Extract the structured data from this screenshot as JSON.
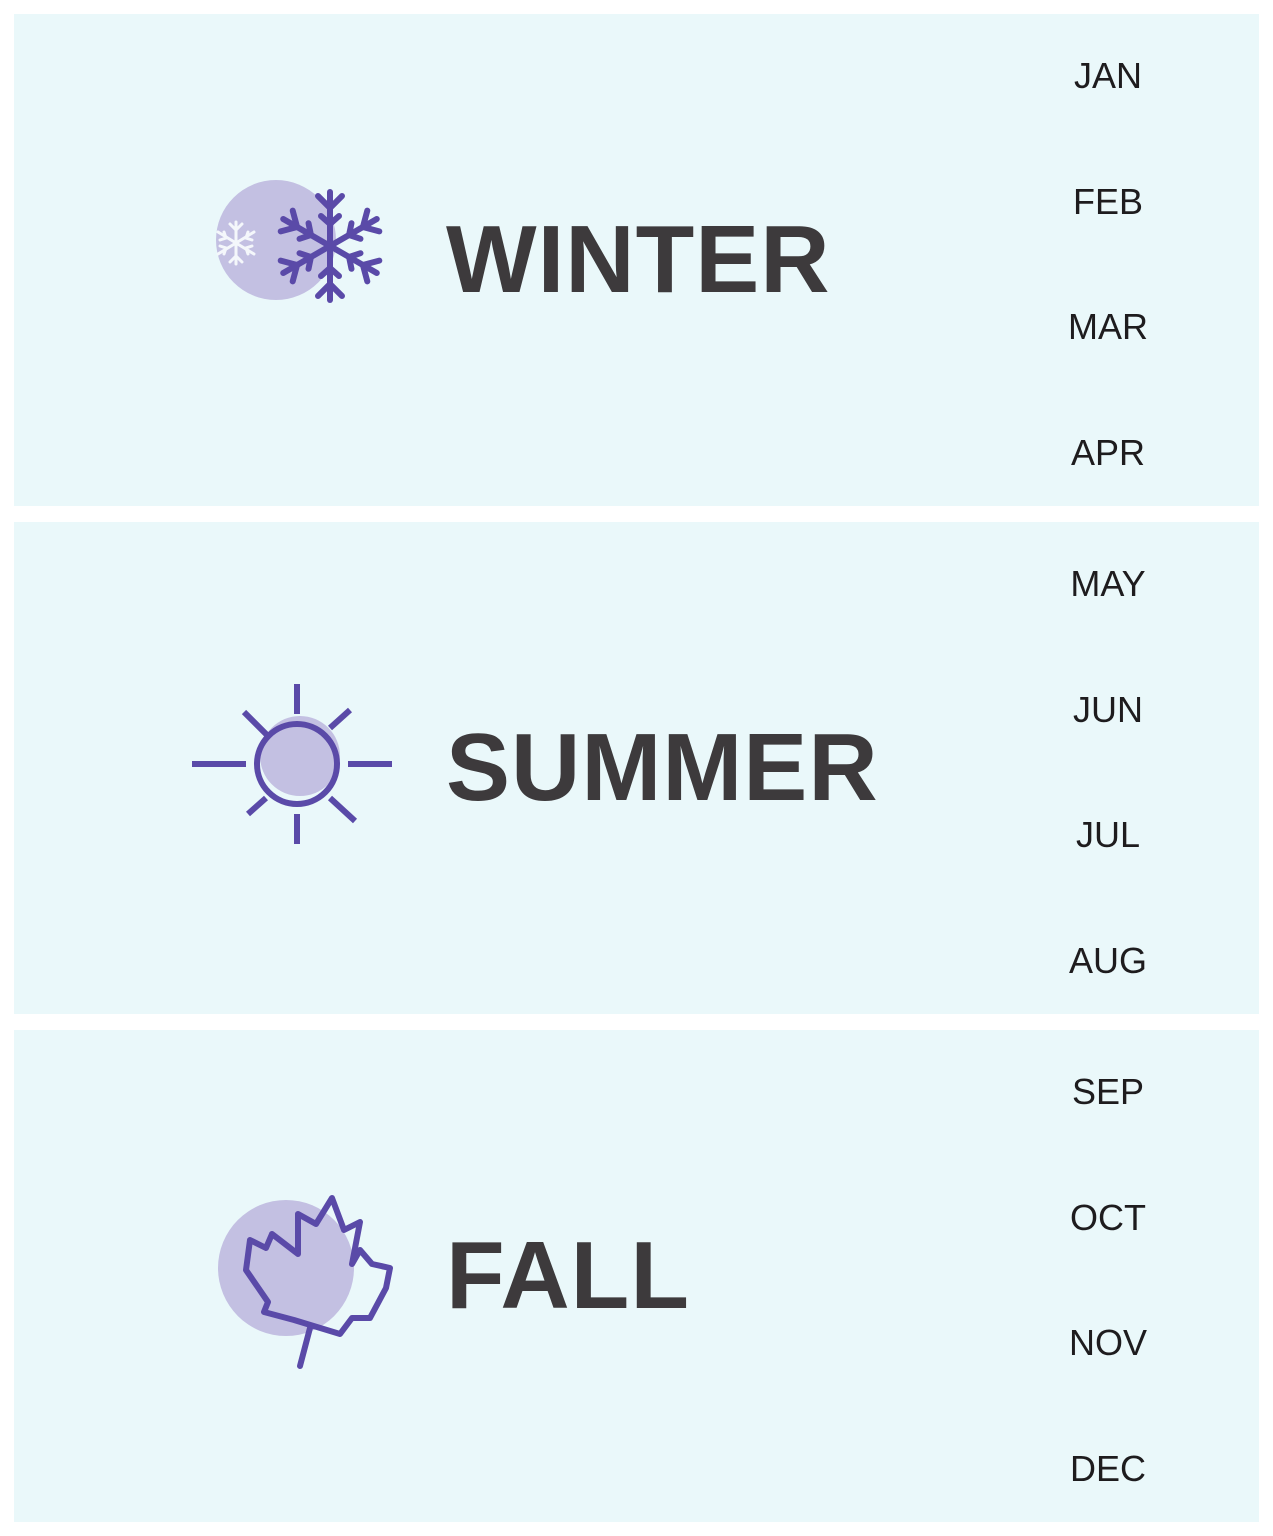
{
  "colors": {
    "panel_background": "#eaf8fa",
    "icon_stroke": "#5a4aa8",
    "icon_fill": "#c3c0e2",
    "label_text": "#3d3a3c",
    "month_text": "#1e1c1e"
  },
  "seasons": [
    {
      "label": "WINTER",
      "icon": "snowflake-icon",
      "months": [
        "JAN",
        "FEB",
        "MAR",
        "APR"
      ]
    },
    {
      "label": "SUMMER",
      "icon": "sun-icon",
      "months": [
        "MAY",
        "JUN",
        "JUL",
        "AUG"
      ]
    },
    {
      "label": "FALL",
      "icon": "maple-leaf-icon",
      "months": [
        "SEP",
        "OCT",
        "NOV",
        "DEC"
      ]
    }
  ]
}
